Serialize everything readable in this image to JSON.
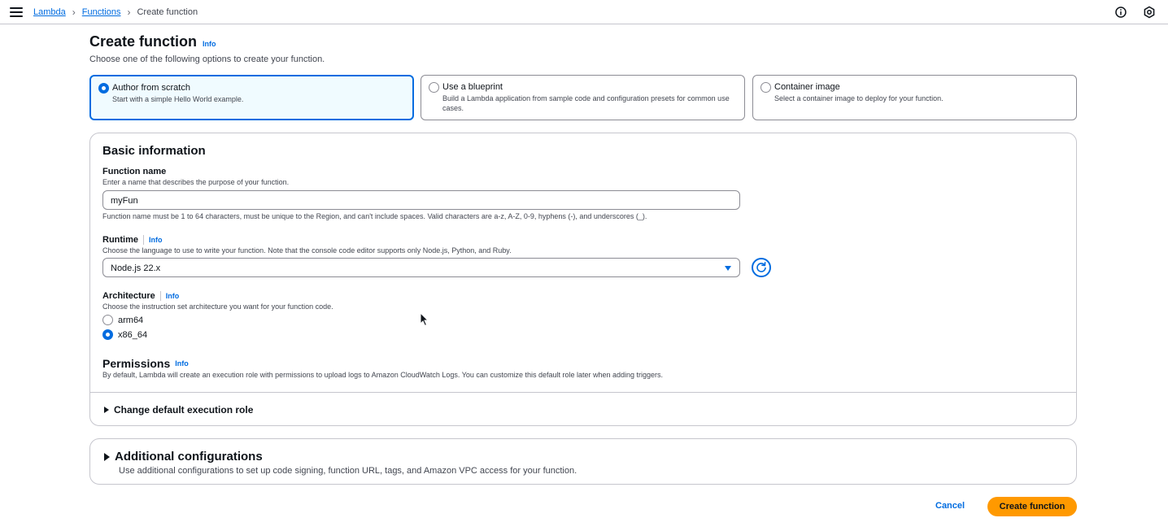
{
  "breadcrumb": {
    "items": [
      "Lambda",
      "Functions"
    ],
    "current": "Create function"
  },
  "header_icons": [
    "info-circle-icon",
    "settings-hexagon-icon"
  ],
  "page": {
    "title": "Create function",
    "info": "Info",
    "description": "Choose one of the following options to create your function."
  },
  "options": [
    {
      "title": "Author from scratch",
      "description": "Start with a simple Hello World example.",
      "selected": true
    },
    {
      "title": "Use a blueprint",
      "description": "Build a Lambda application from sample code and configuration presets for common use cases.",
      "selected": false
    },
    {
      "title": "Container image",
      "description": "Select a container image to deploy for your function.",
      "selected": false
    }
  ],
  "basic": {
    "title": "Basic information",
    "function_name": {
      "label": "Function name",
      "description": "Enter a name that describes the purpose of your function.",
      "value": "myFun",
      "constraint": "Function name must be 1 to 64 characters, must be unique to the Region, and can't include spaces. Valid characters are a-z, A-Z, 0-9, hyphens (-), and underscores (_)."
    },
    "runtime": {
      "label": "Runtime",
      "info": "Info",
      "description": "Choose the language to use to write your function. Note that the console code editor supports only Node.js, Python, and Ruby.",
      "value": "Node.js 22.x"
    },
    "architecture": {
      "label": "Architecture",
      "info": "Info",
      "description": "Choose the instruction set architecture you want for your function code.",
      "options": [
        "arm64",
        "x86_64"
      ],
      "selected": "x86_64"
    },
    "permissions": {
      "title": "Permissions",
      "info": "Info",
      "description": "By default, Lambda will create an execution role with permissions to upload logs to Amazon CloudWatch Logs. You can customize this default role later when adding triggers."
    },
    "change_role": "Change default execution role"
  },
  "additional": {
    "title": "Additional configurations",
    "description": "Use additional configurations to set up code signing, function URL, tags, and Amazon VPC access for your function."
  },
  "actions": {
    "cancel": "Cancel",
    "create": "Create function"
  },
  "colors": {
    "link": "#006ce0",
    "primary_button": "#ff9900",
    "selected_tile_bg": "#f0fbff"
  }
}
